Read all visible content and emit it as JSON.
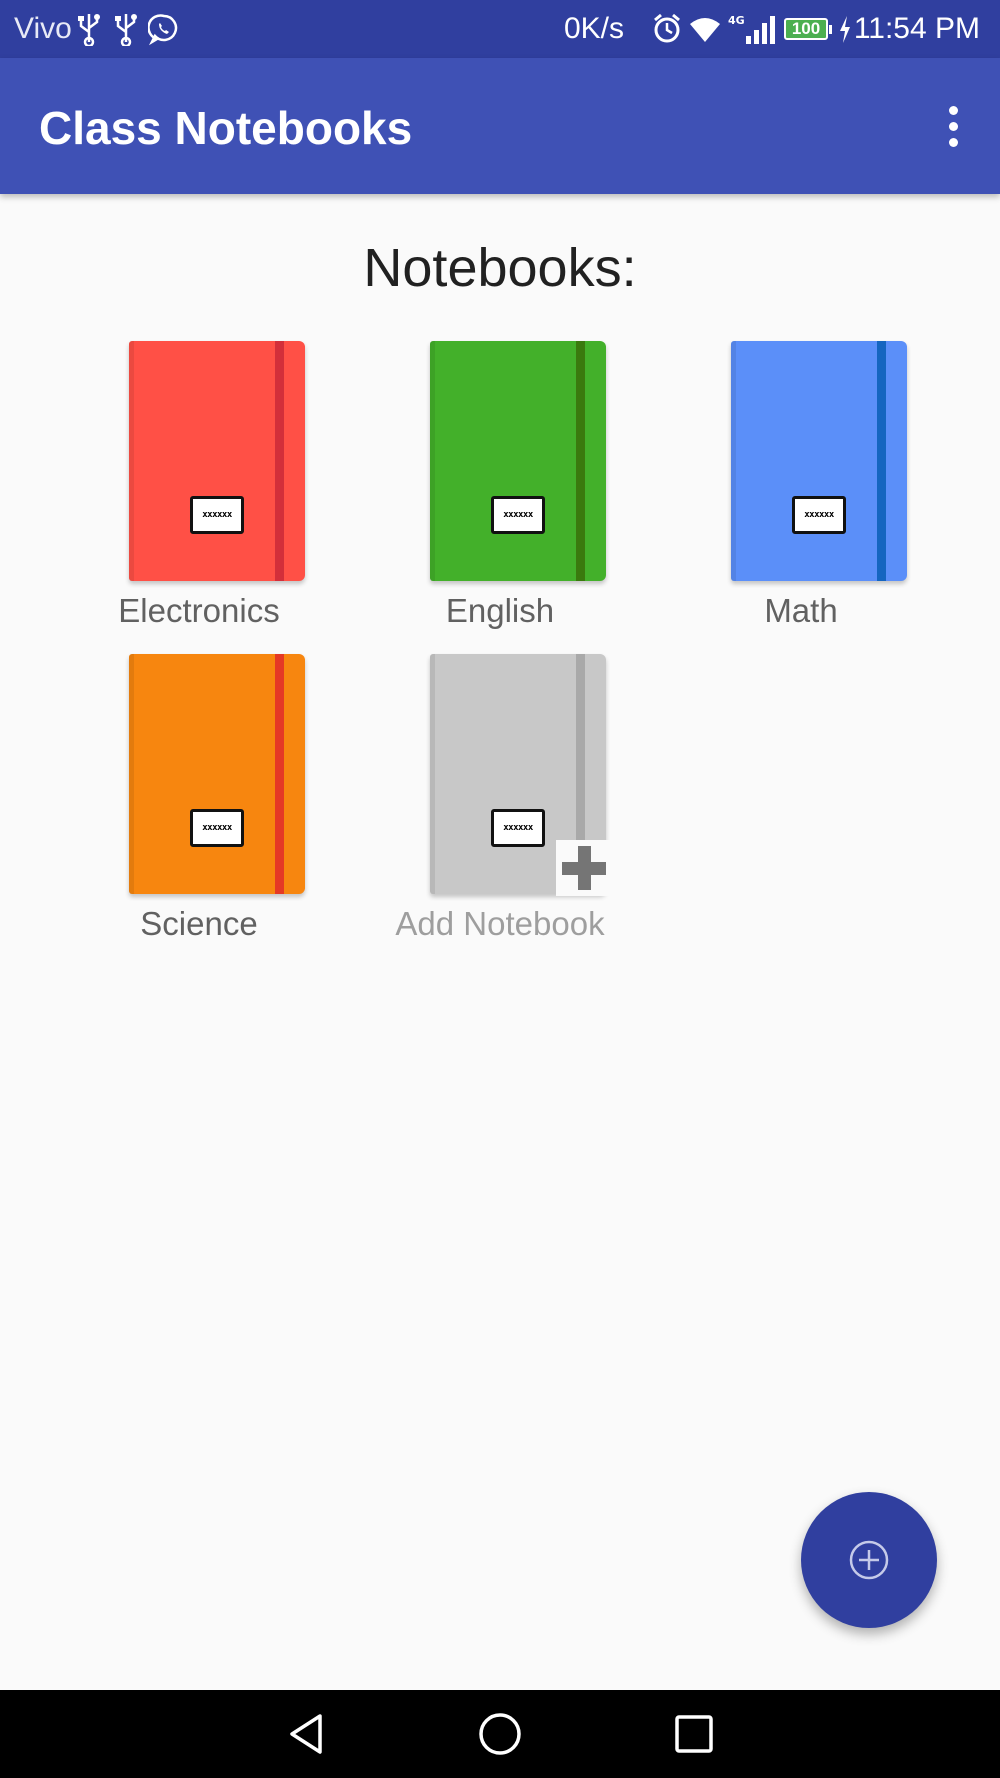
{
  "status_bar": {
    "carrier": "Vivo",
    "net_speed": "0K/s",
    "battery": "100",
    "time": "11:54 PM",
    "icons": [
      "usb-icon",
      "usb-icon",
      "whatsapp-icon",
      "alarm-icon",
      "wifi-icon",
      "signal-4g-icon",
      "charging-icon"
    ]
  },
  "app_bar": {
    "title": "Class Notebooks",
    "overflow_icon": "more-vert-icon"
  },
  "main": {
    "section_title": "Notebooks:",
    "notebooks": [
      {
        "name": "Electronics",
        "label": "xxxxxx",
        "color": "#ff5046",
        "band_color": "#d32f3a"
      },
      {
        "name": "English",
        "label": "xxxxxx",
        "color": "#43b02a",
        "band_color": "#3a7a0e"
      },
      {
        "name": "Math",
        "label": "xxxxxx",
        "color": "#5b8ff9",
        "band_color": "#1565c0"
      },
      {
        "name": "Science",
        "label": "xxxxxx",
        "color": "#f7860f",
        "band_color": "#e53925"
      }
    ],
    "add_notebook": {
      "name": "Add Notebook",
      "label": "xxxxxx",
      "color": "#c8c8c8",
      "band_color": "#a9a9a9",
      "icon": "plus-icon"
    }
  },
  "fab": {
    "icon": "add-circle-icon",
    "color": "#303f9f"
  },
  "nav_bar": {
    "icons": [
      "back-icon",
      "home-icon",
      "recents-icon"
    ]
  }
}
